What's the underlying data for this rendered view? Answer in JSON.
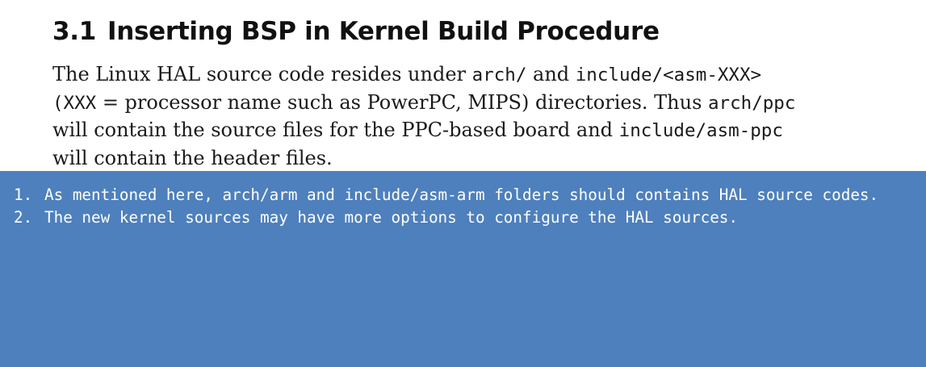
{
  "section": {
    "number": "3.1",
    "title": "Inserting BSP in Kernel Build Procedure"
  },
  "paragraph": {
    "l1_a": "The Linux HAL source code resides under ",
    "l1_code1": "arch/",
    "l1_b": " and ",
    "l1_code2": "include/<asm-XXX>",
    "l2_code1": "(XXX",
    "l2_a": " = processor name such as PowerPC, MIPS) directories. Thus ",
    "l2_code2": "arch/ppc",
    "l3_a": "will contain the source files for the PPC-based board and ",
    "l3_code1": "include/asm-ppc",
    "l4_a": "will contain the header files."
  },
  "notes": {
    "background_color": "#4e80bd",
    "items": [
      {
        "index": "1.",
        "text": "As mentioned here, arch/arm and include/asm-arm folders should contains HAL source codes."
      },
      {
        "index": "2.",
        "text": "The new kernel sources may have more options to configure the HAL sources."
      }
    ]
  }
}
